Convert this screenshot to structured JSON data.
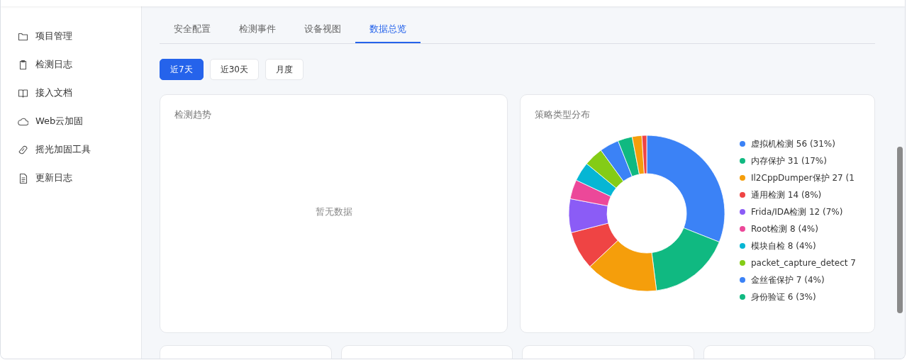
{
  "sidebar": {
    "items": [
      {
        "label": "项目管理"
      },
      {
        "label": "检测日志"
      },
      {
        "label": "接入文档"
      },
      {
        "label": "Web云加固"
      },
      {
        "label": "摇光加固工具"
      },
      {
        "label": "更新日志"
      }
    ]
  },
  "tabs": [
    {
      "label": "安全配置",
      "selected": false
    },
    {
      "label": "检测事件",
      "selected": false
    },
    {
      "label": "设备视图",
      "selected": false
    },
    {
      "label": "数据总览",
      "selected": true
    }
  ],
  "range_buttons": [
    {
      "label": "近7天",
      "selected": true
    },
    {
      "label": "近30天",
      "selected": false
    },
    {
      "label": "月度",
      "selected": false
    }
  ],
  "trend_card": {
    "title": "检测趋势",
    "empty_text": "暂无数据"
  },
  "distribution_card": {
    "title": "策略类型分布",
    "legend": [
      {
        "text": "虚拟机检测  56  (31%)",
        "color": "#3b82f6"
      },
      {
        "text": "内存保护  31  (17%)",
        "color": "#10b981"
      },
      {
        "text": "Il2CppDumper保护  27  (1",
        "color": "#f59e0b"
      },
      {
        "text": "通用检测  14  (8%)",
        "color": "#ef4444"
      },
      {
        "text": "Frida/IDA检测  12  (7%)",
        "color": "#8b5cf6"
      },
      {
        "text": "Root检测  8  (4%)",
        "color": "#ec4899"
      },
      {
        "text": "模块自检  8  (4%)",
        "color": "#06b6d4"
      },
      {
        "text": "packet_capture_detect  7",
        "color": "#84cc16"
      },
      {
        "text": "金丝雀保护  7  (4%)",
        "color": "#3b82f6"
      },
      {
        "text": "身份验证  6  (3%)",
        "color": "#10b981"
      }
    ],
    "chart_data": {
      "type": "donut",
      "values": [
        31,
        17,
        15,
        8,
        7,
        4,
        4,
        4,
        4,
        3,
        2,
        1
      ]
    }
  }
}
